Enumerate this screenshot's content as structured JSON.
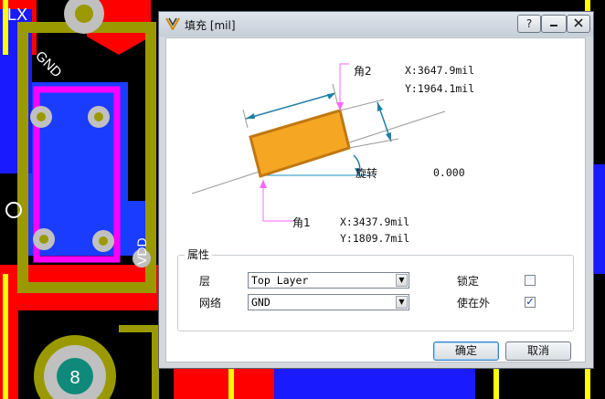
{
  "dialog": {
    "title": "填充 [mil]",
    "help_label": "?"
  },
  "diagram": {
    "corner2_label": "角2",
    "corner2_x": "X:3647.9mil",
    "corner2_y": "Y:1964.1mil",
    "rotation_label": "旋转",
    "rotation_value": "0.000",
    "corner1_label": "角1",
    "corner1_x": "X:3437.9mil",
    "corner1_y": "Y:1809.7mil",
    "fill_color": "#f5a623"
  },
  "properties": {
    "legend": "属性",
    "layer_label": "层",
    "layer_value": "Top Layer",
    "net_label": "网络",
    "net_value": "GND",
    "locked_label": "锁定",
    "locked": false,
    "keepout_label": "使在外",
    "keepout": true
  },
  "buttons": {
    "ok": "确定",
    "cancel": "取消"
  },
  "background": {
    "pcb_label_lx": "LX",
    "pcb_label_gnd": "GND",
    "pcb_label_vdd": "VDD",
    "pad_number": "8"
  }
}
